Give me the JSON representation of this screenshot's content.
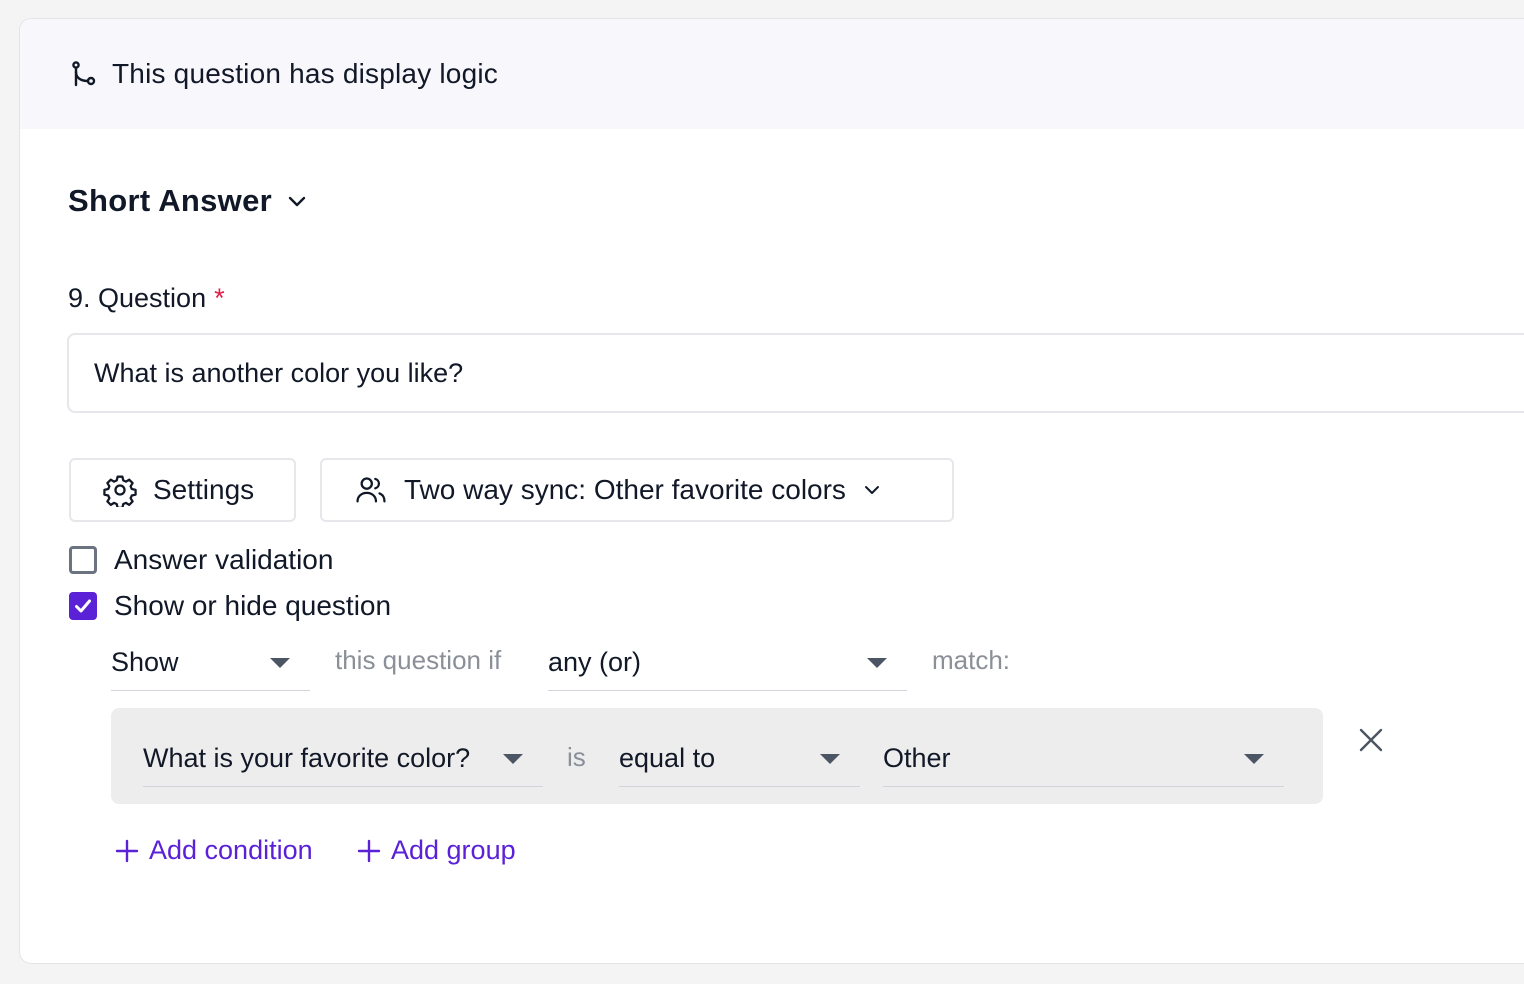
{
  "banner": {
    "text": "This question has display logic",
    "icon": "branch-icon"
  },
  "question_type": {
    "label": "Short Answer"
  },
  "question": {
    "number_label": "9. Question",
    "required_marker": "*",
    "value": "What is another color you like?"
  },
  "toolbar": {
    "settings_label": "Settings",
    "sync_label": "Two way sync: Other favorite colors"
  },
  "options": {
    "answer_validation": {
      "label": "Answer validation",
      "checked": false
    },
    "show_hide": {
      "label": "Show or hide question",
      "checked": true
    }
  },
  "logic": {
    "action": "Show",
    "connector": "this question if",
    "match_mode": "any (or)",
    "match_suffix": "match:",
    "condition": {
      "question": "What is your favorite color?",
      "operator_prefix": "is",
      "operator": "equal to",
      "value": "Other"
    },
    "add_condition_label": "Add condition",
    "add_group_label": "Add group"
  },
  "colors": {
    "accent": "#5b21d6",
    "required": "#e11d48",
    "banner_bg": "#f7f7fc",
    "condition_bg": "#ededed"
  }
}
